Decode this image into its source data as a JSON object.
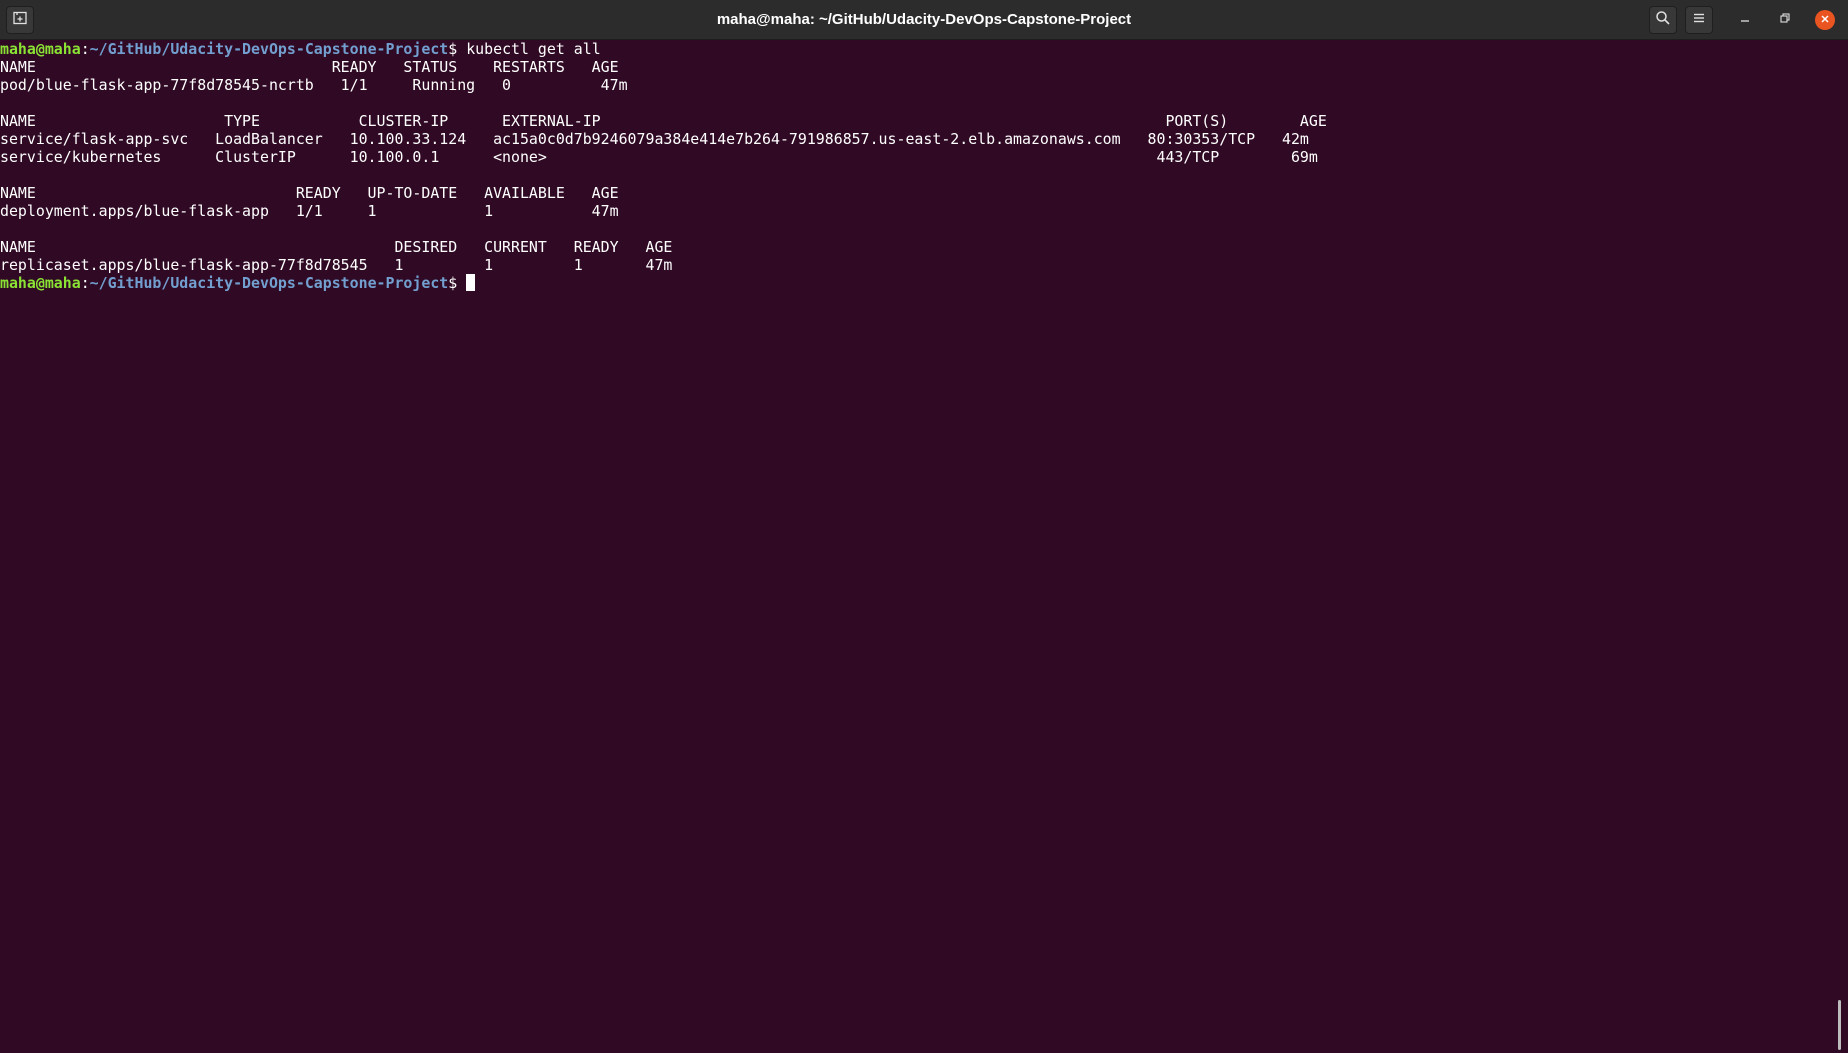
{
  "window": {
    "title": "maha@maha: ~/GitHub/Udacity-DevOps-Capstone-Project"
  },
  "prompt": {
    "user_host": "maha@maha",
    "colon": ":",
    "path": "~/GitHub/Udacity-DevOps-Capstone-Project",
    "dollar": "$ "
  },
  "command": "kubectl get all",
  "output": [
    "NAME                                 READY   STATUS    RESTARTS   AGE",
    "pod/blue-flask-app-77f8d78545-ncrtb   1/1     Running   0          47m",
    "",
    "NAME                     TYPE           CLUSTER-IP      EXTERNAL-IP                                                               PORT(S)        AGE",
    "service/flask-app-svc   LoadBalancer   10.100.33.124   ac15a0c0d7b9246079a384e414e7b264-791986857.us-east-2.elb.amazonaws.com   80:30353/TCP   42m",
    "service/kubernetes      ClusterIP      10.100.0.1      <none>                                                                    443/TCP        69m",
    "",
    "NAME                             READY   UP-TO-DATE   AVAILABLE   AGE",
    "deployment.apps/blue-flask-app   1/1     1            1           47m",
    "",
    "NAME                                        DESIRED   CURRENT   READY   AGE",
    "replicaset.apps/blue-flask-app-77f8d78545   1         1         1       47m"
  ],
  "icons": {
    "new_tab": "new-tab-icon",
    "search": "search-icon",
    "menu": "hamburger-menu-icon",
    "minimize": "minimize-icon",
    "maximize": "maximize-icon",
    "close": "close-icon"
  },
  "colors": {
    "background": "#300a24",
    "prompt_user": "#8ae234",
    "prompt_path": "#729fcf",
    "close_button": "#e95420"
  }
}
